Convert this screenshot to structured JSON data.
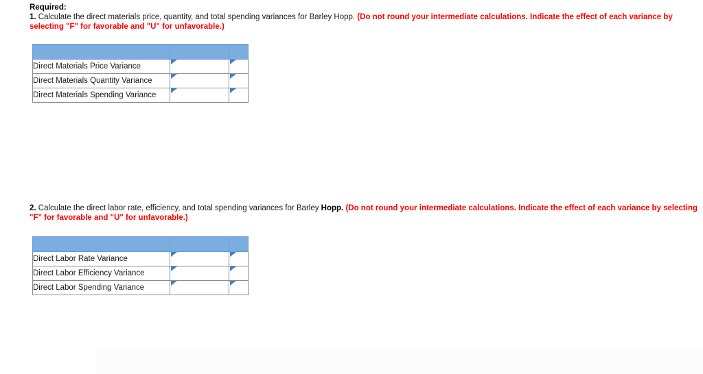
{
  "document": {
    "required_label": "Required:"
  },
  "questions": [
    {
      "number": "1.",
      "text_before": " Calculate the direct materials price, quantity, and total spending variances for Barley Hopp.",
      "bold_tail": "",
      "note": " (Do not round your intermediate calculations. Indicate the effect of each variance by selecting \"F\" for favorable and \"U\" for unfavorable.)"
    },
    {
      "number": "2.",
      "text_before": " Calculate the direct labor rate, efficiency, and total spending variances for Barley ",
      "bold_tail": "Hopp.",
      "note": " (Do not round your intermediate calculations. Indicate the effect of each variance by selecting \"F\" for favorable and \"U\" for unfavorable.)"
    }
  ],
  "tables": [
    {
      "name": "direct-materials-variances",
      "header": {
        "label": "",
        "amount": "",
        "effect": ""
      },
      "rows": [
        {
          "label": "Direct Materials Price Variance",
          "amount": "",
          "effect": ""
        },
        {
          "label": "Direct Materials Quantity Variance",
          "amount": "",
          "effect": ""
        },
        {
          "label": "Direct Materials Spending Variance",
          "amount": "",
          "effect": ""
        }
      ]
    },
    {
      "name": "direct-labor-variances",
      "header": {
        "label": "",
        "amount": "",
        "effect": ""
      },
      "rows": [
        {
          "label": "Direct Labor Rate Variance",
          "amount": "",
          "effect": ""
        },
        {
          "label": "Direct Labor Efficiency Variance",
          "amount": "",
          "effect": ""
        },
        {
          "label": "Direct Labor Spending Variance",
          "amount": "",
          "effect": ""
        }
      ]
    }
  ],
  "colors": {
    "header_blue": "#7bade0",
    "input_border_blue": "#4a7ebb",
    "note_red": "#ff0000",
    "body_text": "#1a1a1a"
  }
}
